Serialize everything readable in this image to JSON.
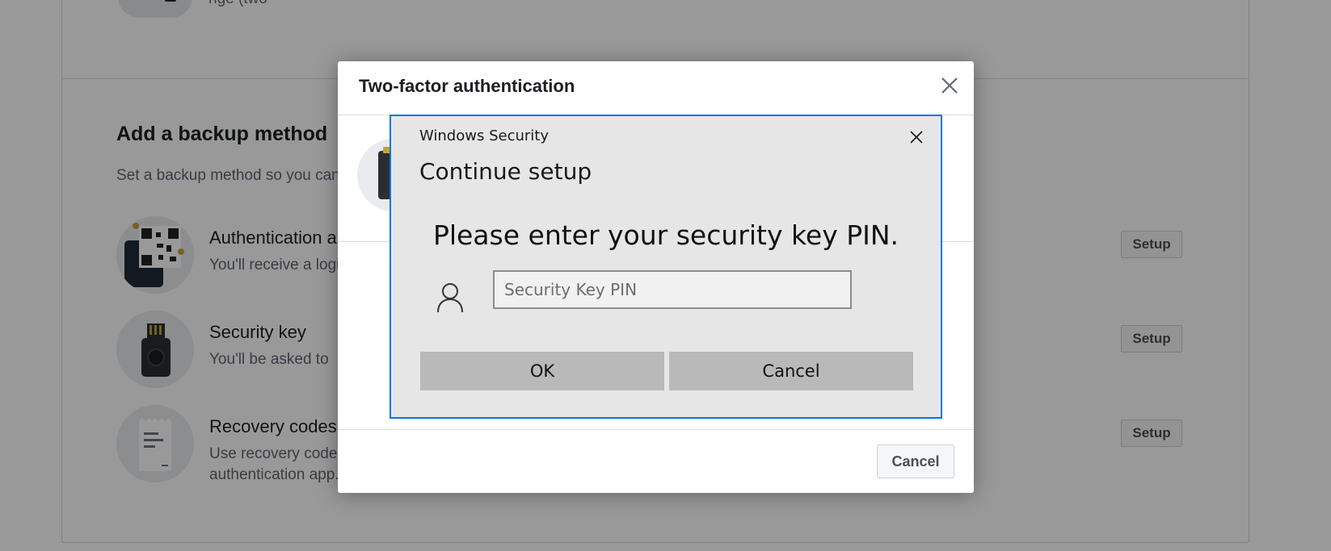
{
  "background": {
    "top_text": "nge (two",
    "heading": "Add a backup method",
    "subtitle": "Set a backup method so you can log in if you lose your security key.",
    "methods": [
      {
        "title": "Authentication app",
        "description": "You'll receive a login code via an authentication app.",
        "button": "Setup",
        "icon": "qr-code-phone-icon"
      },
      {
        "title": "Security key",
        "description": "You'll be asked to",
        "button": "Setup",
        "icon": "usb-security-key-icon"
      },
      {
        "title": "Recovery codes",
        "description": "Use recovery codes to log in if you lose your phone or can't receive a verification code via text message or an authentication app.",
        "button": "Setup",
        "icon": "receipt-document-icon"
      }
    ]
  },
  "modal": {
    "title": "Two-factor authentication",
    "close_icon": "close-icon",
    "cancel_label": "Cancel"
  },
  "windows_security": {
    "caption": "Windows Security",
    "heading": "Continue setup",
    "prompt": "Please enter your security key PIN.",
    "pin_placeholder": "Security Key PIN",
    "ok_label": "OK",
    "cancel_label": "Cancel",
    "accent_color": "#0078d7"
  }
}
